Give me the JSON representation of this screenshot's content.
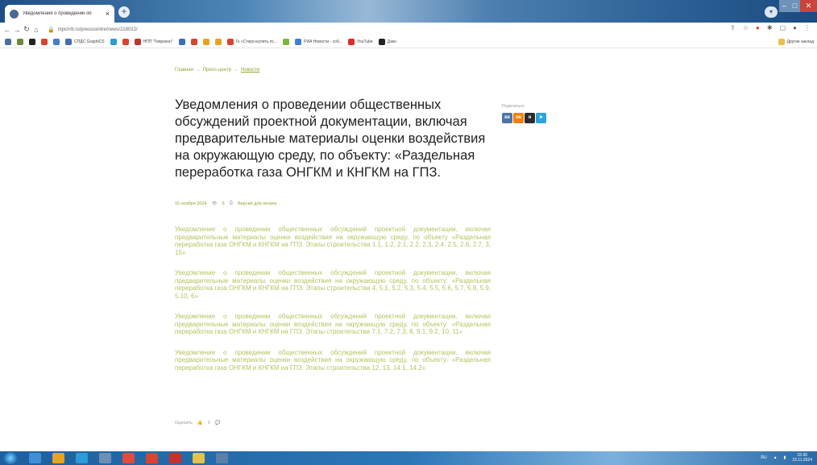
{
  "browser": {
    "tab_title": "Уведомления о проведении об",
    "tab_close": "×",
    "new_tab": "+",
    "url": "mpcnrb.ru/presscentre/news/218022/",
    "window": {
      "minimize": "–",
      "maximize": "□",
      "close": "✕"
    },
    "bookmarks": [
      {
        "label": "",
        "color": "#4b6f9a"
      },
      {
        "label": "",
        "color": "#6b8a3a"
      },
      {
        "label": "",
        "color": "#222222"
      },
      {
        "label": "",
        "color": "#d9432f"
      },
      {
        "label": "",
        "color": "#3f7fd1"
      },
      {
        "label": "СПДС GraphiCS",
        "color": "#3f6fb0"
      },
      {
        "label": "",
        "color": "#2d9bd8"
      },
      {
        "label": "",
        "color": "#d9432f"
      },
      {
        "label": "НПП \"Гипрокон\"",
        "color": "#b73a2f"
      },
      {
        "label": "",
        "color": "#3c6fb6"
      },
      {
        "label": "",
        "color": "#d9432f"
      },
      {
        "label": "",
        "color": "#e8a321"
      },
      {
        "label": "",
        "color": "#e8a321"
      },
      {
        "label": "Гк «Стерх»купить пс...",
        "color": "#d9432f"
      },
      {
        "label": "",
        "color": "#7fb33a"
      },
      {
        "label": "РИА Новости - соб...",
        "color": "#3f7fd1"
      },
      {
        "label": "YouTube",
        "color": "#e02b2b"
      },
      {
        "label": "Дзен",
        "color": "#222222"
      }
    ],
    "other_bookmarks": "Другие заклад"
  },
  "page": {
    "breadcrumb": [
      "Главная",
      "Пресс-центр",
      "Новости"
    ],
    "title": "Уведомления о проведении общественных обсуждений проектной документации, включая предварительные материалы оценки воздействия на окружающую среду, по объекту: «Раздельная переработка газа ОНГКМ и КНГКМ на ГПЗ.",
    "share_label": "Поделиться",
    "share_icons": [
      {
        "name": "vk-icon",
        "glyph": "вк",
        "color": "#4c75a3"
      },
      {
        "name": "ok-icon",
        "glyph": "ок",
        "color": "#ee8208"
      },
      {
        "name": "ya-icon",
        "glyph": "я",
        "color": "#2b2b2b"
      },
      {
        "name": "telegram-icon",
        "glyph": "➤",
        "color": "#2aa3e0"
      }
    ],
    "date": "15 ноября 2024",
    "views": "5",
    "print_label": "Версия для печати",
    "documents": [
      "Уведомление о проведении общественных обсуждений проектной документации, включая предварительные материалы оценки воздействия на окружающую среду, по объекту «Раздельная переработка газа ОНГКМ и КНГКМ на ГПЗ. Этапы строительства 1.1, 1.2, 2.1, 2.2, 2.3, 2.4, 2.5, 2.6, 2.7, 3, 15»",
      "Уведомление о проведении общественных обсуждений проектной документации, включая предварительные материалы оценки воздействия на окружающую среду, по объекту: «Раздельная переработка газа ОНГКМ и КНГКМ на ГПЗ. Этапы строительства 4, 5.1, 5.2, 5.3, 5.4, 5.5, 5.6, 5.7, 5.8, 5.9, 5.10, 6»",
      "Уведомление о проведении общественных обсуждений проектной документации, включая предварительные материалы оценки воздействия на окружающую среду, по объекту: «Раздельная переработка газа ОНГКМ и КНГКМ на ГПЗ. Этапы строительства 7.1, 7.2, 7.3, 8, 9.1, 9.2, 10, 11»",
      "Уведомление о проведении общественных обсуждений проектной документации, включая предварительные материалы оценки воздействия на окружающую среду, по объекту: «Раздельная переработка газа ОНГКМ и КНГКМ на ГПЗ. Этапы строительства 12, 13, 14.1, 14.2»"
    ],
    "rate_label": "Оценить",
    "likes": "0"
  },
  "taskbar": {
    "apps": [
      "#3f8fd6",
      "#e8a321",
      "#2d9bd8",
      "#6d8fb4",
      "#e44b3b",
      "#d9432f",
      "#c9302c",
      "#e8c04a",
      "#5b7fa8"
    ],
    "lang": "RU",
    "time": "15:30",
    "date": "15.11.2024"
  }
}
